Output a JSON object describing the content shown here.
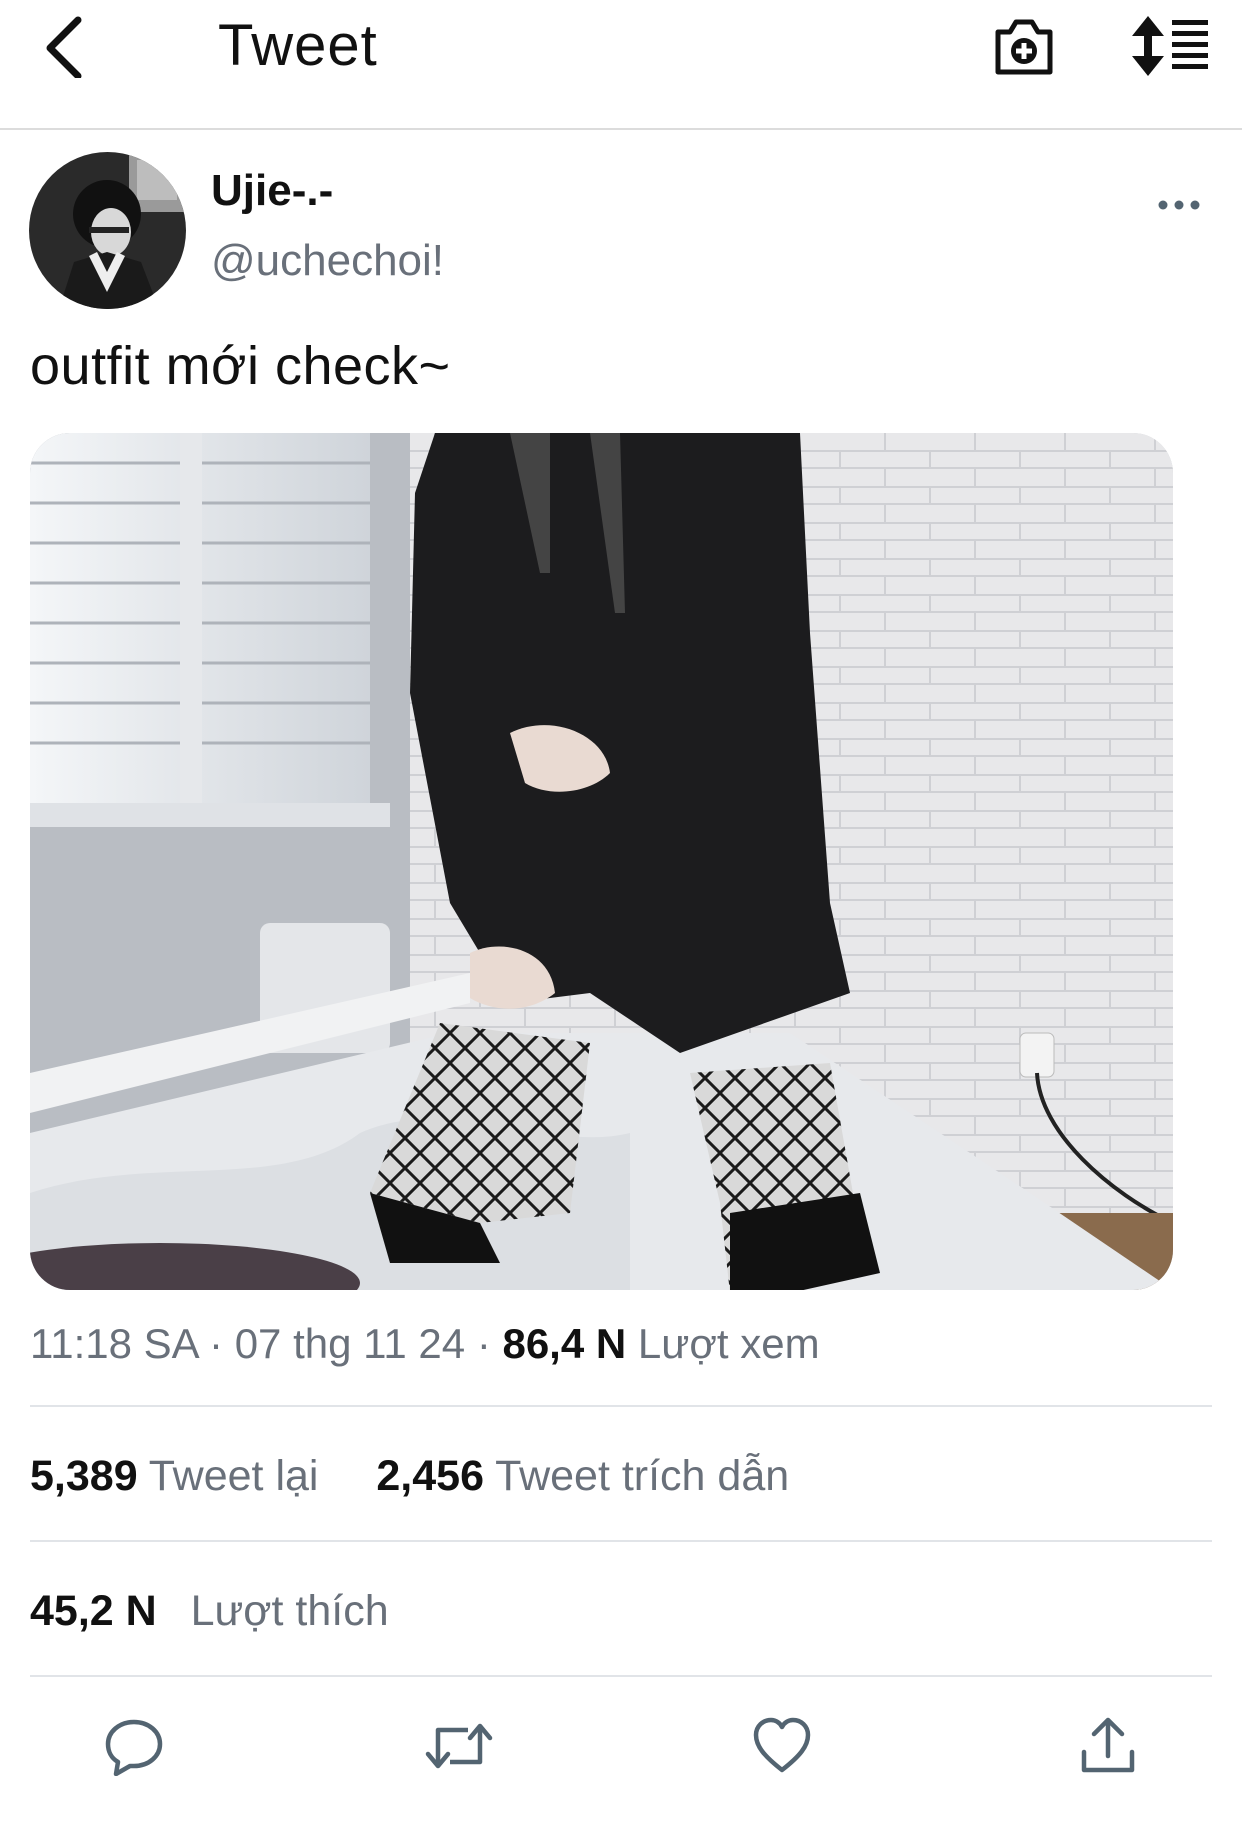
{
  "header": {
    "title": "Tweet",
    "icons": [
      "back-arrow-icon",
      "camera-plus-icon",
      "sort-lines-icon"
    ]
  },
  "tweet": {
    "display_name": "Ujie-.-",
    "handle": "@uchechoi!",
    "text": "outfit mới check~",
    "time": "11:18 SA",
    "date": "07 thg 11 24",
    "views_count": "86,4 N",
    "views_label": "Lượt xem",
    "retweets_count": "5,389",
    "retweets_label": "Tweet lại",
    "quotes_count": "2,456",
    "quotes_label": "Tweet trích dẫn",
    "likes_count": "45,2 N",
    "likes_label": "Lượt thích"
  },
  "actions": [
    "reply-icon",
    "retweet-icon",
    "like-icon",
    "share-icon"
  ],
  "colors": {
    "text_primary": "#0f1419",
    "text_secondary": "#69707a",
    "divider": "#e1e4e8",
    "icon": "#536471"
  }
}
